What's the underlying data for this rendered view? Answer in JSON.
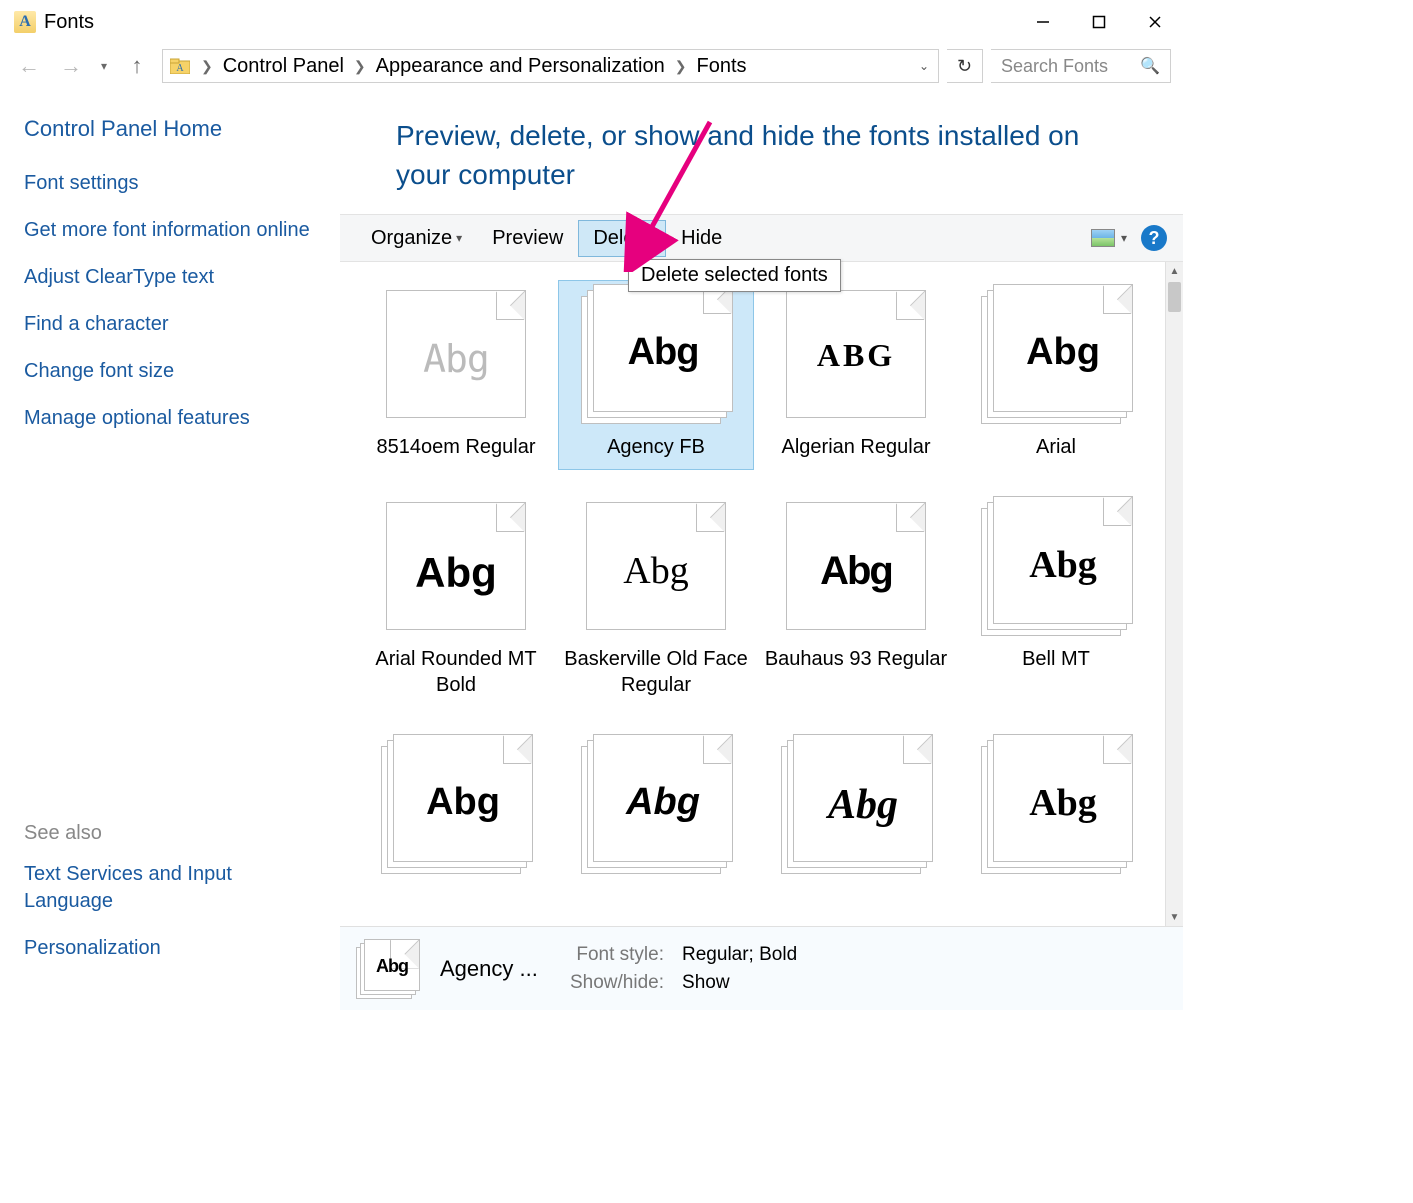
{
  "window": {
    "title": "Fonts"
  },
  "breadcrumb": {
    "items": [
      "Control Panel",
      "Appearance and Personalization",
      "Fonts"
    ]
  },
  "search": {
    "placeholder": "Search Fonts"
  },
  "sidebar": {
    "home": "Control Panel Home",
    "links": [
      "Font settings",
      "Get more font information online",
      "Adjust ClearType text",
      "Find a character",
      "Change font size",
      "Manage optional features"
    ],
    "see_also_header": "See also",
    "see_also": [
      "Text Services and Input Language",
      "Personalization"
    ]
  },
  "page": {
    "heading": "Preview, delete, or show and hide the fonts installed on your computer"
  },
  "toolbar": {
    "organize": "Organize",
    "preview": "Preview",
    "delete": "Delete",
    "hide": "Hide",
    "tooltip": "Delete selected fonts"
  },
  "fonts": [
    {
      "label": "8514oem Regular",
      "sample": "Abg",
      "style": "dim",
      "stack": false
    },
    {
      "label": "Agency FB",
      "sample": "Abg",
      "style": "s-agency",
      "stack": true,
      "selected": true
    },
    {
      "label": "Algerian Regular",
      "sample": "ABG",
      "style": "s-algerian",
      "stack": false
    },
    {
      "label": "Arial",
      "sample": "Abg",
      "style": "s-arial",
      "stack": true
    },
    {
      "label": "Arial Rounded MT Bold",
      "sample": "Abg",
      "style": "s-armt",
      "stack": false
    },
    {
      "label": "Baskerville Old Face Regular",
      "sample": "Abg",
      "style": "s-bask",
      "stack": false
    },
    {
      "label": "Bauhaus 93 Regular",
      "sample": "Abg",
      "style": "s-bauhaus",
      "stack": false
    },
    {
      "label": "Bell MT",
      "sample": "Abg",
      "style": "s-bell",
      "stack": true
    },
    {
      "label": "",
      "sample": "Abg",
      "style": "s-r3c1",
      "stack": true
    },
    {
      "label": "",
      "sample": "Abg",
      "style": "s-r3c2",
      "stack": true
    },
    {
      "label": "",
      "sample": "Abg",
      "style": "s-r3c3",
      "stack": true
    },
    {
      "label": "",
      "sample": "Abg",
      "style": "s-r3c4",
      "stack": true
    }
  ],
  "details": {
    "name": "Agency ...",
    "fields": {
      "font_style_key": "Font style:",
      "font_style_val": "Regular; Bold",
      "show_hide_key": "Show/hide:",
      "show_hide_val": "Show"
    }
  }
}
